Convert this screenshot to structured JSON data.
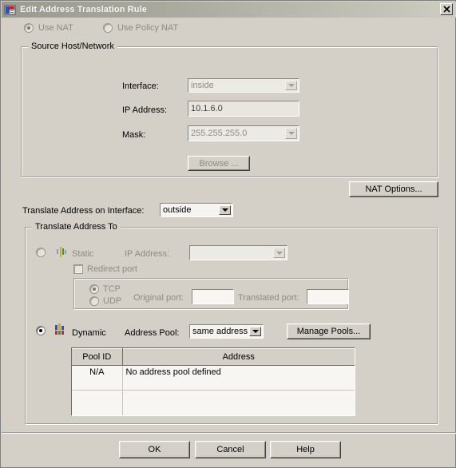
{
  "window": {
    "title": "Edit Address Translation Rule",
    "icon": "app-icon",
    "close_label": "✕"
  },
  "nat_mode": {
    "use_nat": {
      "label": "Use NAT",
      "selected": true,
      "disabled": true
    },
    "use_policy_nat": {
      "label": "Use Policy NAT",
      "selected": false,
      "disabled": true
    }
  },
  "source_group": {
    "title": "Source Host/Network",
    "interface": {
      "label": "Interface:",
      "value": "inside",
      "disabled": true
    },
    "ip_address": {
      "label": "IP Address:",
      "value": "10.1.6.0",
      "disabled": true
    },
    "mask": {
      "label": "Mask:",
      "value": "255.255.255.0",
      "disabled": true
    },
    "browse_button": {
      "label": "Browse ...",
      "disabled": true
    }
  },
  "nat_options_button": {
    "label": "NAT Options..."
  },
  "translate_on_interface": {
    "label": "Translate Address on Interface:",
    "value": "outside"
  },
  "translate_group": {
    "title": "Translate Address To",
    "static": {
      "label": "Static",
      "selected": false,
      "disabled": true,
      "icon": "static-nat-icon",
      "ip_address_label": "IP Address:",
      "ip_address_value": ""
    },
    "redirect_port": {
      "label": "Redirect port",
      "checked": false,
      "disabled": true
    },
    "protocol": {
      "tcp": {
        "label": "TCP",
        "selected": true,
        "disabled": true
      },
      "udp": {
        "label": "UDP",
        "selected": false,
        "disabled": true
      }
    },
    "original_port": {
      "label": "Original port:",
      "value": ""
    },
    "translated_port": {
      "label": "Translated port:",
      "value": ""
    },
    "dynamic": {
      "label": "Dynamic",
      "selected": true,
      "icon": "dynamic-nat-icon",
      "address_pool_label": "Address Pool:",
      "address_pool_value": "same address"
    },
    "manage_pools_button": {
      "label": "Manage Pools..."
    },
    "pool_table": {
      "columns": [
        "Pool ID",
        "Address"
      ],
      "rows": [
        {
          "pool_id": "N/A",
          "address": "No address pool defined"
        }
      ]
    }
  },
  "footer": {
    "ok": "OK",
    "cancel": "Cancel",
    "help": "Help"
  },
  "colors": {
    "dialog_bg": "#d4d0c8",
    "titlebar_start": "#9a9a8e",
    "titlebar_end": "#cdcdc2",
    "field_bg": "#f5f4f1",
    "disabled_text": "#8e8b83"
  }
}
